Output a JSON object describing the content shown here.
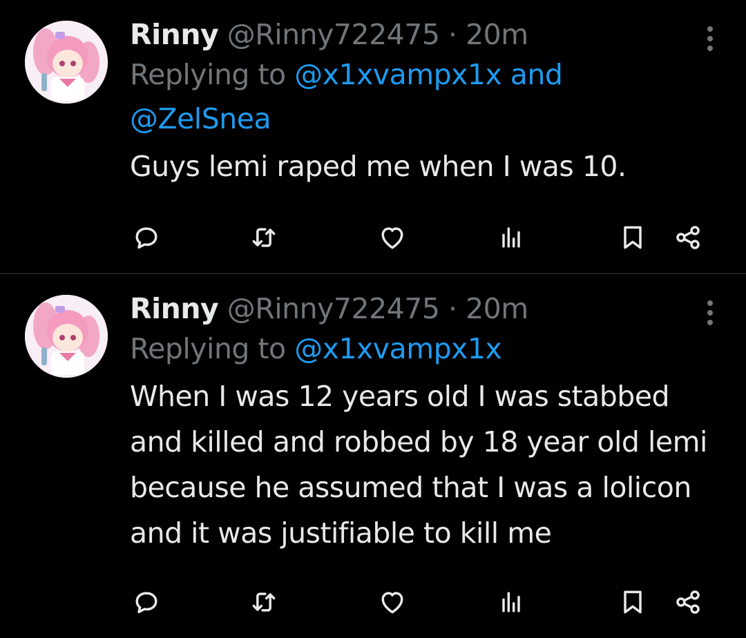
{
  "tweets": [
    {
      "name": "Rinny",
      "handle": "@Rinny722475",
      "separator": "·",
      "time": "20m",
      "replying_prefix": "Replying to ",
      "mention1": "@x1xvampx1x",
      "mention_joiner": " and",
      "mention2": "@ZelSnea",
      "text": "Guys lemi raped me when I was 10."
    },
    {
      "name": "Rinny",
      "handle": "@Rinny722475",
      "separator": "·",
      "time": "20m",
      "replying_prefix": "Replying to ",
      "mention1": "@x1xvampx1x",
      "text": "When I was 12 years old I was stabbed and killed and robbed by 18 year old lemi because he assumed that I was a lolicon and it was justifiable to kill me"
    }
  ],
  "icons": {
    "reply": "reply-icon",
    "retweet": "retweet-icon",
    "like": "heart-icon",
    "views": "views-icon",
    "bookmark": "bookmark-icon",
    "share": "share-icon",
    "more": "more-icon"
  },
  "colors": {
    "background": "#000000",
    "text": "#e7e9ea",
    "secondary": "#71767b",
    "link": "#1d9bf0",
    "divider": "#2f3336"
  }
}
